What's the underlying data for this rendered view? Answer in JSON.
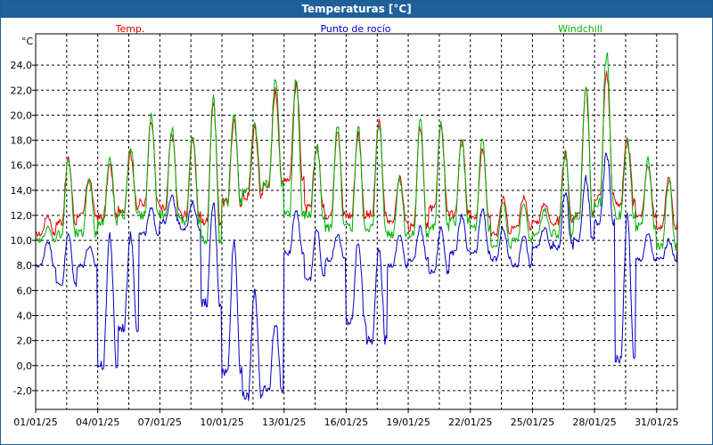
{
  "window": {
    "title": "Temperaturas [°C]"
  },
  "colors": {
    "titlebar": "#1f5f9a",
    "temp": "#e00000",
    "dew": "#0000c0",
    "windchill": "#00b000"
  },
  "chart_data": {
    "type": "line",
    "title": "Temperaturas [°C]",
    "ylabel": "°C",
    "ylim": [
      -3.5,
      26.5
    ],
    "yticks": [
      "-2,0",
      "0,0",
      "2,0",
      "4,0",
      "6,0",
      "8,0",
      "10,0",
      "12,0",
      "14,0",
      "16,0",
      "18,0",
      "20,0",
      "22,0",
      "24,0"
    ],
    "xlim": [
      "01/01/25",
      "01/02/25"
    ],
    "xticks": [
      "01/01/25",
      "04/01/25",
      "07/01/25",
      "10/01/25",
      "13/01/25",
      "16/01/25",
      "19/01/25",
      "22/01/25",
      "25/01/25",
      "28/01/25",
      "31/01/25"
    ],
    "grid": true,
    "legend": "top",
    "series": [
      {
        "name": "Temp.",
        "color": "#e00000",
        "x": [
          "01/01/25",
          "02/01/25",
          "03/01/25",
          "04/01/25",
          "05/01/25",
          "06/01/25",
          "07/01/25",
          "08/01/25",
          "09/01/25",
          "10/01/25",
          "11/01/25",
          "12/01/25",
          "13/01/25",
          "14/01/25",
          "15/01/25",
          "16/01/25",
          "17/01/25",
          "18/01/25",
          "19/01/25",
          "20/01/25",
          "21/01/25",
          "22/01/25",
          "23/01/25",
          "24/01/25",
          "25/01/25",
          "26/01/25",
          "27/01/25",
          "28/01/25",
          "29/01/25",
          "30/01/25",
          "31/01/25",
          "01/02/25"
        ],
        "min": [
          10.5,
          11.5,
          12.0,
          11.8,
          12.5,
          13.0,
          12.5,
          12.0,
          11.5,
          13.0,
          13.5,
          14.5,
          15.0,
          12.5,
          12.0,
          12.0,
          12.0,
          11.5,
          11.0,
          12.5,
          12.0,
          12.0,
          10.5,
          11.0,
          11.5,
          11.5,
          12.0,
          13.5,
          13.0,
          12.0,
          11.0,
          11.5
        ],
        "max": [
          12.0,
          16.5,
          15.0,
          16.0,
          17.0,
          19.5,
          18.5,
          18.0,
          21.0,
          19.5,
          19.0,
          22.0,
          22.5,
          17.5,
          19.0,
          18.5,
          19.5,
          15.0,
          19.0,
          19.0,
          18.0,
          17.5,
          13.5,
          13.5,
          13.0,
          17.0,
          22.0,
          23.5,
          18.0,
          16.0,
          15.0,
          11.5
        ]
      },
      {
        "name": "Punto de rocío",
        "color": "#0000c0",
        "x": [
          "01/01/25",
          "02/01/25",
          "03/01/25",
          "04/01/25",
          "05/01/25",
          "06/01/25",
          "07/01/25",
          "08/01/25",
          "09/01/25",
          "10/01/25",
          "11/01/25",
          "12/01/25",
          "13/01/25",
          "14/01/25",
          "15/01/25",
          "16/01/25",
          "17/01/25",
          "18/01/25",
          "19/01/25",
          "20/01/25",
          "21/01/25",
          "22/01/25",
          "23/01/25",
          "24/01/25",
          "25/01/25",
          "26/01/25",
          "27/01/25",
          "28/01/25",
          "29/01/25",
          "30/01/25",
          "31/01/25",
          "01/02/25"
        ],
        "min": [
          8.0,
          6.5,
          8.0,
          0.0,
          3.0,
          10.5,
          11.5,
          11.0,
          5.0,
          -0.5,
          -2.5,
          -2.0,
          9.0,
          7.0,
          8.5,
          3.5,
          2.0,
          8.0,
          8.5,
          7.5,
          9.0,
          9.0,
          8.5,
          8.0,
          9.5,
          9.5,
          10.0,
          11.5,
          0.5,
          8.5,
          8.5,
          9.5
        ],
        "max": [
          10.0,
          10.5,
          9.5,
          10.5,
          10.5,
          12.5,
          13.5,
          13.0,
          13.0,
          10.0,
          6.0,
          3.5,
          12.5,
          11.0,
          10.5,
          10.0,
          9.5,
          10.5,
          11.0,
          11.0,
          12.0,
          12.5,
          11.0,
          10.5,
          11.0,
          14.0,
          15.0,
          17.0,
          12.0,
          10.5,
          10.0,
          10.0
        ]
      },
      {
        "name": "Windchill",
        "color": "#00b000",
        "x": [
          "01/01/25",
          "02/01/25",
          "03/01/25",
          "04/01/25",
          "05/01/25",
          "06/01/25",
          "07/01/25",
          "08/01/25",
          "09/01/25",
          "10/01/25",
          "11/01/25",
          "12/01/25",
          "13/01/25",
          "14/01/25",
          "15/01/25",
          "16/01/25",
          "17/01/25",
          "18/01/25",
          "19/01/25",
          "20/01/25",
          "21/01/25",
          "22/01/25",
          "23/01/25",
          "24/01/25",
          "25/01/25",
          "26/01/25",
          "27/01/25",
          "28/01/25",
          "29/01/25",
          "30/01/25",
          "31/01/25",
          "01/02/25"
        ],
        "min": [
          10.0,
          10.5,
          10.5,
          11.5,
          12.0,
          12.0,
          12.0,
          11.5,
          10.0,
          13.0,
          14.0,
          14.5,
          12.0,
          12.0,
          11.0,
          11.0,
          11.0,
          10.5,
          10.5,
          11.0,
          11.5,
          11.0,
          9.5,
          10.0,
          10.5,
          10.5,
          12.0,
          13.0,
          12.0,
          11.0,
          9.5,
          9.5
        ],
        "max": [
          11.0,
          16.5,
          15.0,
          16.5,
          17.5,
          20.0,
          19.0,
          18.5,
          21.5,
          20.0,
          19.5,
          23.0,
          23.0,
          17.5,
          19.0,
          19.0,
          19.5,
          15.0,
          19.5,
          19.5,
          18.0,
          18.0,
          13.0,
          13.0,
          12.5,
          17.0,
          22.5,
          25.0,
          18.0,
          16.5,
          15.0,
          10.5
        ]
      }
    ]
  }
}
